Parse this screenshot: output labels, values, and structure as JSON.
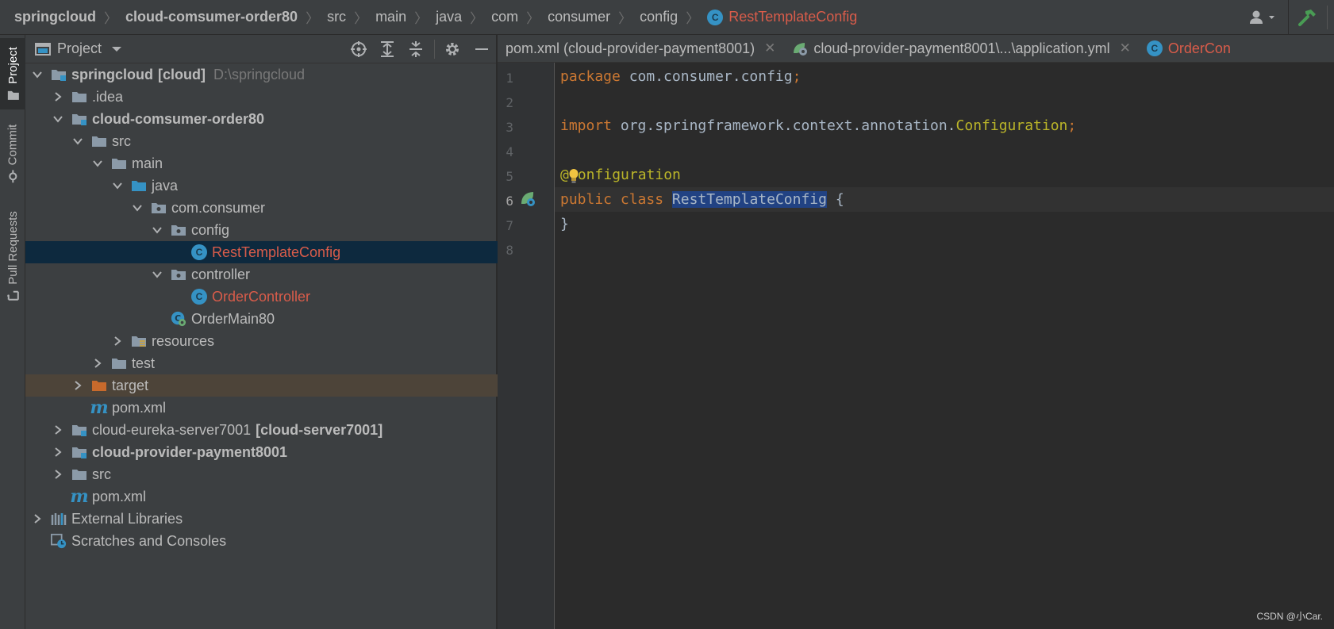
{
  "breadcrumb": {
    "items": [
      "springcloud",
      "cloud-comsumer-order80",
      "src",
      "main",
      "java",
      "com",
      "consumer",
      "config",
      "RestTemplateConfig"
    ]
  },
  "toolstrip": {
    "tabs": [
      "Project",
      "Commit",
      "Pull Requests"
    ]
  },
  "project_panel": {
    "title": "Project",
    "tree": [
      {
        "label": "springcloud",
        "tag": "[cloud]",
        "path": "D:\\springcloud"
      },
      {
        "label": ".idea"
      },
      {
        "label": "cloud-comsumer-order80"
      },
      {
        "label": "src"
      },
      {
        "label": "main"
      },
      {
        "label": "java"
      },
      {
        "label": "com.consumer"
      },
      {
        "label": "config"
      },
      {
        "label": "RestTemplateConfig"
      },
      {
        "label": "controller"
      },
      {
        "label": "OrderController"
      },
      {
        "label": "OrderMain80"
      },
      {
        "label": "resources"
      },
      {
        "label": "test"
      },
      {
        "label": "target"
      },
      {
        "label": "pom.xml"
      },
      {
        "label": "cloud-eureka-server7001",
        "tag": "[cloud-server7001]"
      },
      {
        "label": "cloud-provider-payment8001"
      },
      {
        "label": "src"
      },
      {
        "label": "pom.xml"
      },
      {
        "label": "External Libraries"
      },
      {
        "label": "Scratches and Consoles"
      }
    ]
  },
  "editor": {
    "tabs": [
      {
        "label": "pom.xml (cloud-provider-payment8001)"
      },
      {
        "label": "cloud-provider-payment8001\\...\\application.yml"
      },
      {
        "label": "OrderCon"
      }
    ],
    "line_numbers": [
      "1",
      "2",
      "3",
      "4",
      "5",
      "6",
      "7",
      "8"
    ],
    "code": {
      "l1_kw": "package",
      "l1_id": " com.consumer.config",
      "l1_semi": ";",
      "l3_kw": "import",
      "l3_id": " org.springframework.context.annotation.",
      "l3_cls": "Configuration",
      "l3_semi": ";",
      "l5_at": "@",
      "l5_ann": "onfiguration",
      "l6_kw1": "public",
      "l6_kw2": "class",
      "l6_sel": "RestTemplateConfig",
      "l6_brace": " {",
      "l7": "}"
    }
  },
  "watermark": "CSDN @小Car.",
  "colors": {
    "background": "#2b2b2b",
    "panel": "#3c3f41",
    "selection": "#0d293e",
    "excluded": "#4d4439",
    "keyword": "#cc7832",
    "annotation": "#bbb529",
    "class_error": "#d95c4a",
    "class_icon": "#3592c4"
  }
}
